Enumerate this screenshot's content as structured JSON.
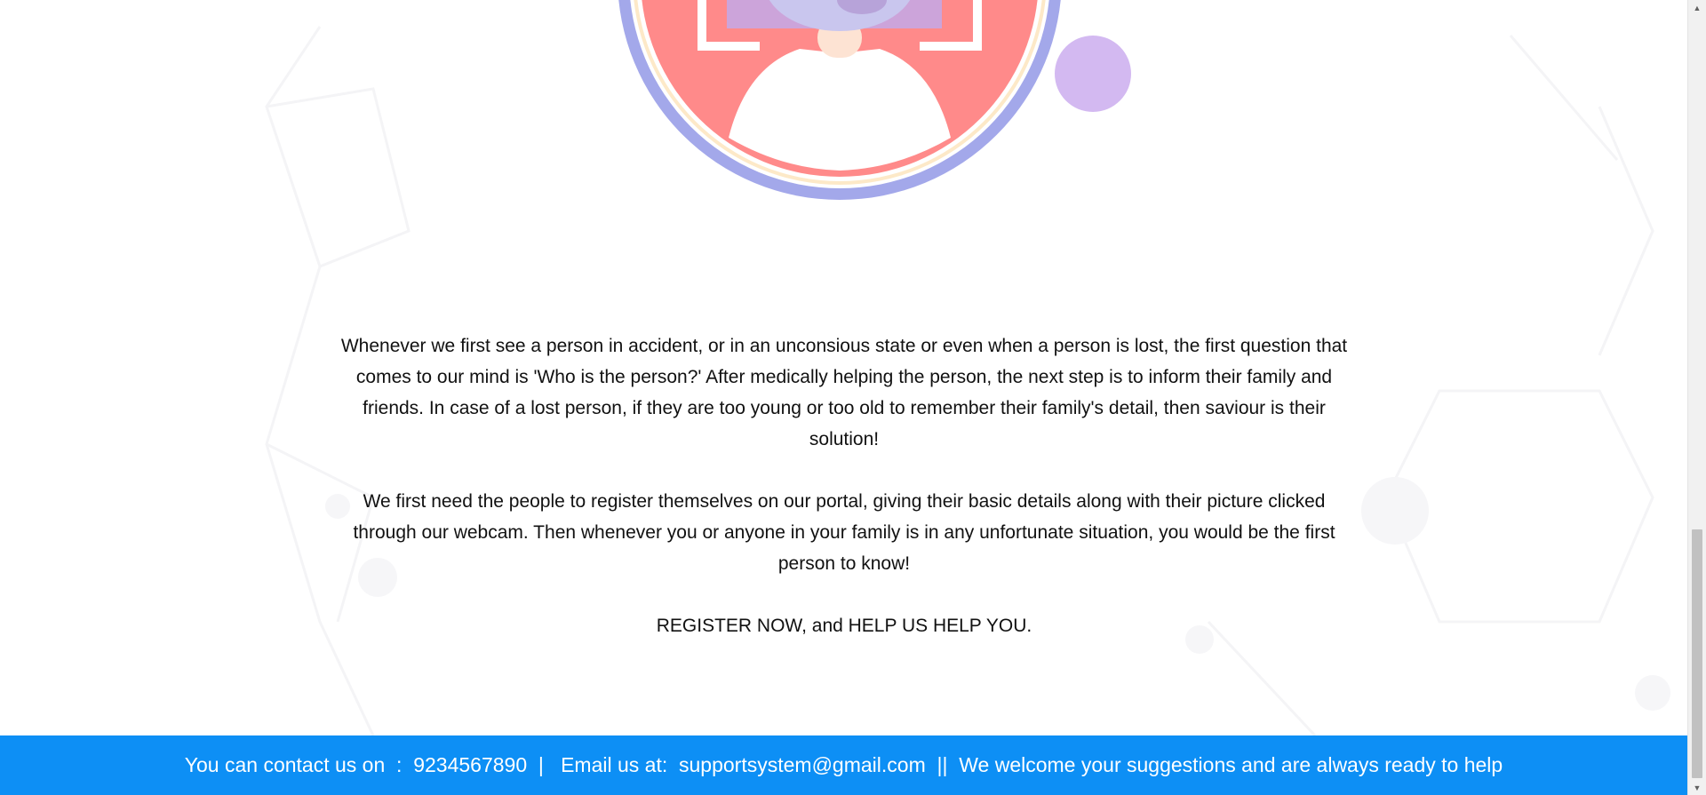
{
  "main": {
    "paragraphs": [
      "Whenever we first see a person in accident, or in an unconsious state or even when a person is lost, the first question that comes to our mind is 'Who is the person?' After medically helping the person, the next step is to inform their family and friends. In case of a lost person, if they are too young or too old to remember their family's detail, then saviour is their solution!",
      "We first need the people to register themselves on our portal, giving their basic details along with their picture clicked through our webcam. Then whenever you or anyone in your family is in any unfortunate situation, you would be the first person to know!",
      "REGISTER NOW, and HELP US HELP YOU."
    ]
  },
  "footer": {
    "contact_prefix": "You can contact us on  :  ",
    "phone": "9234567890",
    "sep1": "  |   ",
    "email_prefix": "Email us at:  ",
    "email": "supportsystem@gmail.com",
    "sep2": "  ||  ",
    "message": "We welcome your suggestions and are always ready to help"
  },
  "colors": {
    "footer_bg": "#0d8ff5",
    "ring": "#a3a8ea",
    "face_circle": "#ff8a8a",
    "bubble": "#b58ae8"
  },
  "icons": {
    "hero": "face-recognition-illustration",
    "scroll_up": "scroll-up-arrow-icon",
    "scroll_down": "scroll-down-arrow-icon"
  }
}
